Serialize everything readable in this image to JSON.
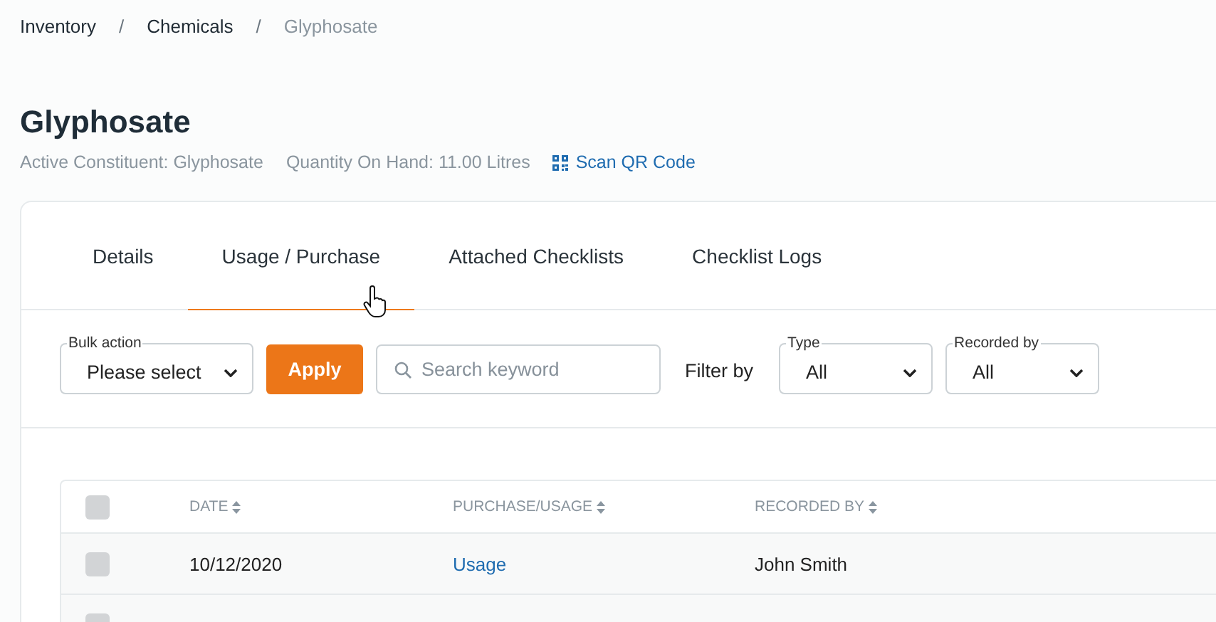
{
  "breadcrumb": [
    {
      "label": "Inventory",
      "current": false
    },
    {
      "label": "Chemicals",
      "current": false
    },
    {
      "label": "Glyphosate",
      "current": true
    }
  ],
  "breadcrumb_separator": "/",
  "title": "Glyphosate",
  "meta": {
    "active_constituent": "Active Constituent: Glyphosate",
    "quantity": "Quantity On Hand: 11.00 Litres",
    "scan_link": "Scan QR Code"
  },
  "tabs": [
    {
      "label": "Details",
      "selected": false
    },
    {
      "label": "Usage / Purchase",
      "selected": true
    },
    {
      "label": "Attached Checklists",
      "selected": false
    },
    {
      "label": "Checklist Logs",
      "selected": false
    }
  ],
  "toolbar": {
    "bulk_action": {
      "label": "Bulk action",
      "value": "Please select"
    },
    "apply_button": "Apply",
    "search": {
      "placeholder": "Search keyword"
    },
    "filter_label": "Filter by",
    "filters": [
      {
        "label": "Type",
        "value": "All"
      },
      {
        "label": "Recorded by",
        "value": "All"
      }
    ]
  },
  "table": {
    "header_checked": false,
    "columns": [
      "DATE",
      "PURCHASE/USAGE",
      "RECORDED BY"
    ],
    "rows": [
      {
        "checked": false,
        "date": "10/12/2020",
        "type": "Usage",
        "recorded_by": "John Smith"
      },
      {
        "checked": false
      }
    ]
  }
}
